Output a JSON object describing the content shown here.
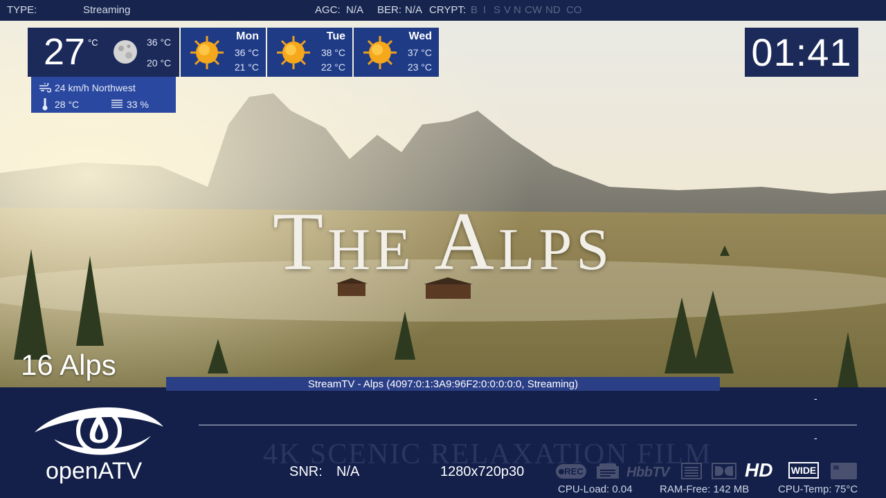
{
  "topbar": {
    "type_label": "TYPE:",
    "type_value": "Streaming",
    "agc_label": "AGC:",
    "agc_value": "N/A",
    "ber_label": "BER:",
    "ber_value": "N/A",
    "crypt_label": "CRYPT:",
    "crypt_flags": [
      "B",
      "I",
      "S",
      "V",
      "N",
      "CW",
      "ND",
      "CO"
    ]
  },
  "weather": {
    "current": {
      "temp": "27",
      "unit": "°C",
      "icon": "moon-icon",
      "high": "36 °C",
      "low": "20 °C"
    },
    "days": [
      {
        "name": "Mon",
        "high": "36 °C",
        "low": "21 °C",
        "icon": "sun-icon"
      },
      {
        "name": "Tue",
        "high": "38 °C",
        "low": "22 °C",
        "icon": "sun-icon"
      },
      {
        "name": "Wed",
        "high": "37 °C",
        "low": "23 °C",
        "icon": "sun-icon"
      }
    ],
    "wind": "24 km/h Northwest",
    "feels_like": "28 °C",
    "humidity": "33 %"
  },
  "clock": "01:41",
  "video": {
    "title_parts": [
      "T",
      "HE ",
      "A",
      "LPS"
    ],
    "subtitle": "4K SCENIC RELAXATION FILM"
  },
  "channel": {
    "number_name": "16 Alps"
  },
  "service_line": "StreamTV - Alps (4097:0:1:3A9:96F2:0:0:0:0:0, Streaming)",
  "infobar": {
    "logo_text": "openATV",
    "now_dash": "-",
    "next_dash": "-",
    "snr_label": "SNR:",
    "snr_value": "N/A",
    "resolution": "1280x720p30",
    "icons": [
      "rec-icon",
      "teletext-icon",
      "hbbtv-icon",
      "subtitles-icon",
      "dolby-icon",
      "hd-icon",
      "wide-icon",
      "card-icon"
    ],
    "icon_labels": {
      "rec": "REC",
      "hbbtv": "HbbTV",
      "hd": "HD",
      "wide": "WIDE"
    },
    "cpu_load": "CPU-Load: 0.04",
    "ram_free": "RAM-Free: 142 MB",
    "cpu_temp": "CPU-Temp: 75°C"
  },
  "colors": {
    "panel_dark": "#1c2a5a",
    "panel_blue": "#1f3b86",
    "service_bar": "#2b3f86",
    "infobar": "#14204a"
  }
}
